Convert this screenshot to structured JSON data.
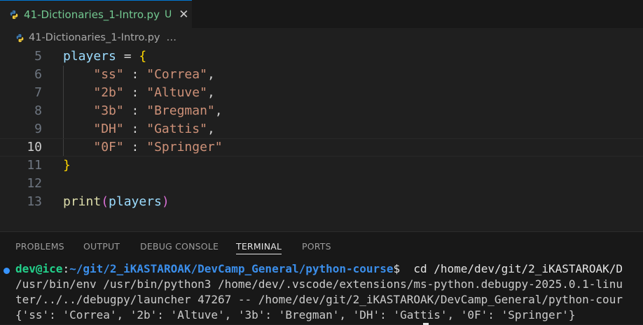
{
  "tab": {
    "title": "41-Dictionaries_1-Intro.py",
    "badge": "U",
    "close_glyph": "✕"
  },
  "breadcrumb": {
    "file": "41-Dictionaries_1-Intro.py",
    "more": "…"
  },
  "editor": {
    "lines": [
      {
        "num": "5"
      },
      {
        "num": "6"
      },
      {
        "num": "7"
      },
      {
        "num": "8"
      },
      {
        "num": "9"
      },
      {
        "num": "10"
      },
      {
        "num": "11"
      },
      {
        "num": "12"
      },
      {
        "num": "13"
      }
    ],
    "code": {
      "var": "players",
      "assign": " = ",
      "open_brace": "{",
      "close_brace": "}",
      "entries": [
        {
          "key": "\"ss\"",
          "sep": " : ",
          "val": "\"Correa\"",
          "comma": ","
        },
        {
          "key": "\"2b\"",
          "sep": " : ",
          "val": "\"Altuve\"",
          "comma": ","
        },
        {
          "key": "\"3b\"",
          "sep": " : ",
          "val": "\"Bregman\"",
          "comma": ","
        },
        {
          "key": "\"DH\"",
          "sep": " : ",
          "val": "\"Gattis\"",
          "comma": ","
        },
        {
          "key": "\"0F\"",
          "sep": " : ",
          "val": "\"Springer\"",
          "comma": ""
        }
      ],
      "print_fn": "print",
      "print_open": "(",
      "print_arg": "players",
      "print_close": ")"
    }
  },
  "panel": {
    "tabs": [
      {
        "label": "PROBLEMS"
      },
      {
        "label": "OUTPUT"
      },
      {
        "label": "DEBUG CONSOLE"
      },
      {
        "label": "TERMINAL",
        "active": true
      },
      {
        "label": "PORTS"
      }
    ]
  },
  "terminal": {
    "user": "dev@ice",
    "colon": ":",
    "path": "~/git/2_iKASTAROAK/DevCamp_General/python-course",
    "prompt": "$",
    "cmd": "  cd /home/dev/git/2_iKASTAROAK/D",
    "line2": "/usr/bin/env /usr/bin/python3 /home/dev/.vscode/extensions/ms-python.debugpy-2025.0.1-linu",
    "line3": "ter/../../debugpy/launcher 47267 -- /home/dev/git/2_iKASTAROAK/DevCamp_General/python-cour",
    "line4": "{'ss': 'Correa', '2b': 'Altuve', '3b': 'Bregman', 'DH': 'Gattis', '0F': 'Springer'}"
  },
  "colors": {
    "accent": "#0078d4",
    "untracked_file": "#73c991",
    "terminal_dot": "#3794ff"
  }
}
